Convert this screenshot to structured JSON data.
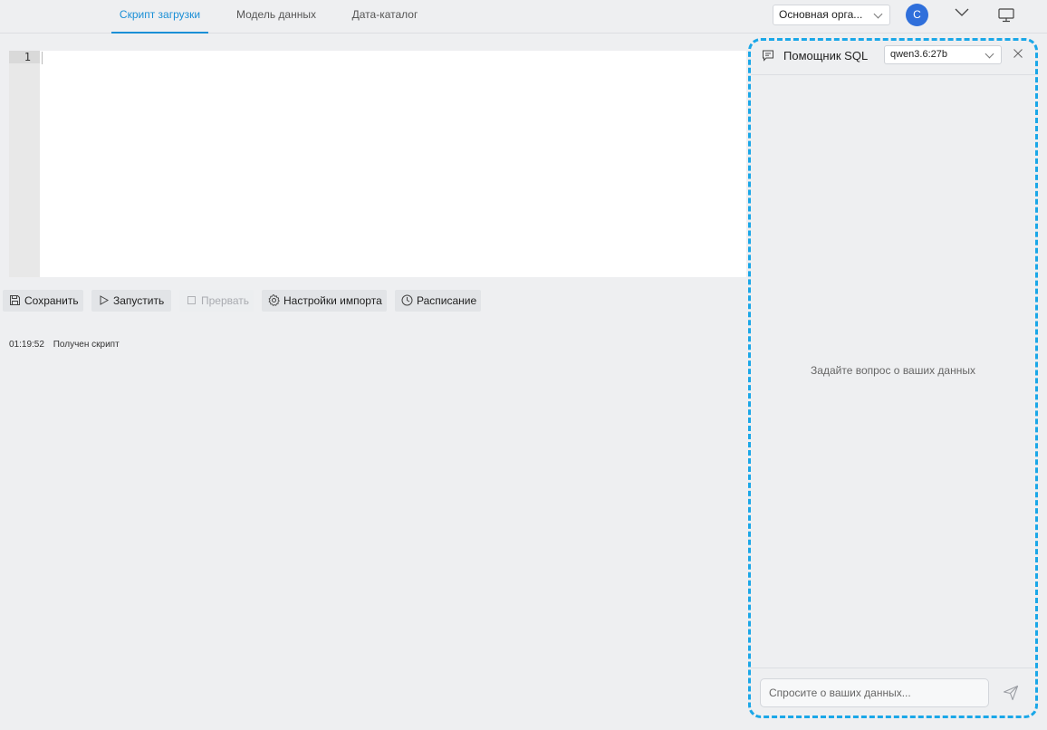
{
  "tabs": [
    {
      "label": "Скрипт загрузки"
    },
    {
      "label": "Модель данных"
    },
    {
      "label": "Дата-каталог"
    }
  ],
  "header": {
    "org_selected": "Основная орга...",
    "avatar_initial": "С"
  },
  "editor": {
    "line_number": "1"
  },
  "toolbar": {
    "save": "Сохранить",
    "run": "Запустить",
    "abort": "Прервать",
    "import_settings": "Настройки импорта",
    "schedule": "Расписание"
  },
  "log": [
    {
      "time": "01:19:52",
      "message": "Получен скрипт"
    }
  ],
  "assistant": {
    "title": "Помощник SQL",
    "model": "qwen3.6:27b",
    "empty_message": "Задайте вопрос о ваших данных",
    "input_placeholder": "Спросите о ваших данных..."
  },
  "colors": {
    "accent": "#1a8fd6",
    "avatar": "#2f6fdb",
    "panel_highlight": "#1aa7e8"
  }
}
